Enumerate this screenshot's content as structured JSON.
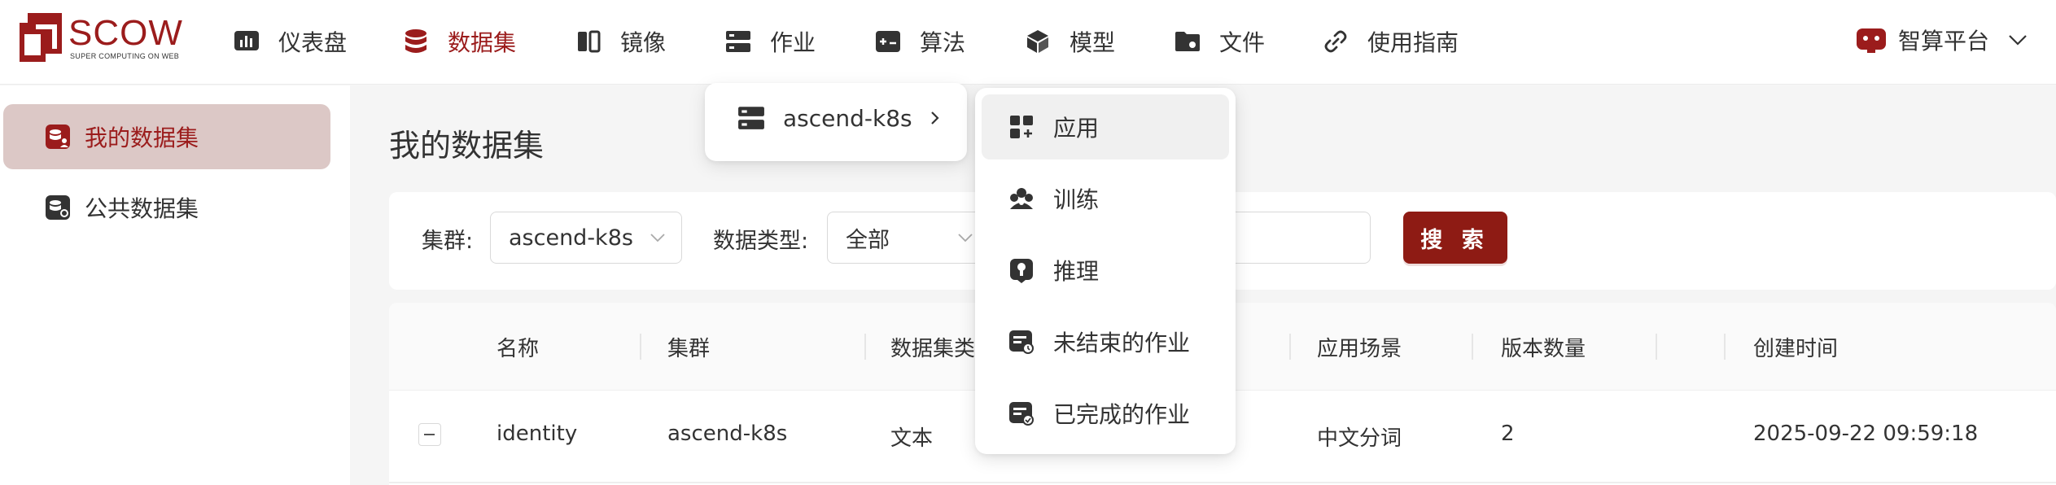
{
  "brand": {
    "name": "SCOW",
    "tagline": "SUPER COMPUTING ON WEB",
    "color": "#9b1c1c"
  },
  "nav": [
    {
      "label": "仪表盘",
      "icon": "dashboard-icon"
    },
    {
      "label": "数据集",
      "icon": "database-icon",
      "active": true
    },
    {
      "label": "镜像",
      "icon": "mirror-icon"
    },
    {
      "label": "作业",
      "icon": "server-icon"
    },
    {
      "label": "算法",
      "icon": "algorithm-icon"
    },
    {
      "label": "模型",
      "icon": "cube-icon"
    },
    {
      "label": "文件",
      "icon": "folder-icon"
    },
    {
      "label": "使用指南",
      "icon": "link-icon"
    }
  ],
  "platform": {
    "label": "智算平台",
    "icon": "robot-icon"
  },
  "sidebar": {
    "items": [
      {
        "label": "我的数据集",
        "icon": "my-dataset-icon",
        "active": true
      },
      {
        "label": "公共数据集",
        "icon": "public-dataset-icon"
      }
    ]
  },
  "page": {
    "title": "我的数据集"
  },
  "filters": {
    "cluster_label": "集群:",
    "cluster_value": "ascend-k8s",
    "type_label": "数据类型:",
    "type_value": "全部",
    "search_label": "搜 索"
  },
  "table": {
    "headers": [
      "名称",
      "集群",
      "数据集类",
      "应用场景",
      "版本数量",
      "创建时间"
    ],
    "rows": [
      {
        "name": "identity",
        "cluster": "ascend-k8s",
        "type": "文本",
        "scene": "中文分词",
        "versions": "2",
        "created": "2025-09-22 09:59:18"
      }
    ]
  },
  "job_menu": {
    "cluster": {
      "label": "ascend-k8s",
      "icon": "server-icon"
    },
    "items": [
      {
        "label": "应用",
        "icon": "apps-icon",
        "hover": true
      },
      {
        "label": "训练",
        "icon": "training-icon"
      },
      {
        "label": "推理",
        "icon": "inference-icon"
      },
      {
        "label": "未结束的作业",
        "icon": "running-job-icon"
      },
      {
        "label": "已完成的作业",
        "icon": "finished-job-icon"
      }
    ]
  }
}
